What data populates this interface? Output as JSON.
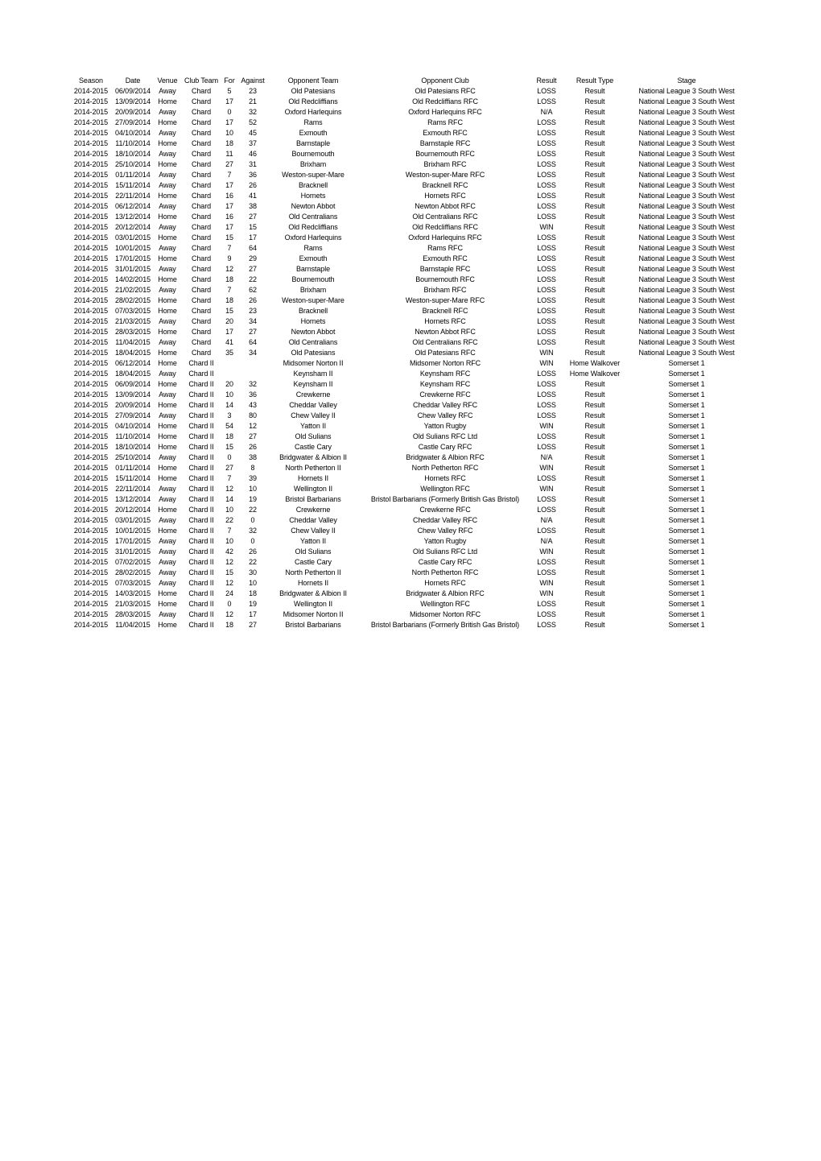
{
  "headers": [
    "Season",
    "Date",
    "Venue",
    "Club Team",
    "For",
    "Against",
    "Opponent Team",
    "Opponent Club",
    "Result",
    "Result Type",
    "Stage"
  ],
  "rows": [
    [
      "2014-2015",
      "06/09/2014",
      "Away",
      "Chard",
      "5",
      "23",
      "Old Patesians",
      "Old Patesians RFC",
      "LOSS",
      "Result",
      "National League 3 South West"
    ],
    [
      "2014-2015",
      "13/09/2014",
      "Home",
      "Chard",
      "17",
      "21",
      "Old Redcliffians",
      "Old Redcliffians RFC",
      "LOSS",
      "Result",
      "National League 3 South West"
    ],
    [
      "2014-2015",
      "20/09/2014",
      "Away",
      "Chard",
      "0",
      "32",
      "Oxford Harlequins",
      "Oxford Harlequins RFC",
      "N/A",
      "Result",
      "National League 3 South West"
    ],
    [
      "2014-2015",
      "27/09/2014",
      "Home",
      "Chard",
      "17",
      "52",
      "Rams",
      "Rams RFC",
      "LOSS",
      "Result",
      "National League 3 South West"
    ],
    [
      "2014-2015",
      "04/10/2014",
      "Away",
      "Chard",
      "10",
      "45",
      "Exmouth",
      "Exmouth RFC",
      "LOSS",
      "Result",
      "National League 3 South West"
    ],
    [
      "2014-2015",
      "11/10/2014",
      "Home",
      "Chard",
      "18",
      "37",
      "Barnstaple",
      "Barnstaple RFC",
      "LOSS",
      "Result",
      "National League 3 South West"
    ],
    [
      "2014-2015",
      "18/10/2014",
      "Away",
      "Chard",
      "11",
      "46",
      "Bournemouth",
      "Bournemouth RFC",
      "LOSS",
      "Result",
      "National League 3 South West"
    ],
    [
      "2014-2015",
      "25/10/2014",
      "Home",
      "Chard",
      "27",
      "31",
      "Brixham",
      "Brixham RFC",
      "LOSS",
      "Result",
      "National League 3 South West"
    ],
    [
      "2014-2015",
      "01/11/2014",
      "Away",
      "Chard",
      "7",
      "36",
      "Weston-super-Mare",
      "Weston-super-Mare RFC",
      "LOSS",
      "Result",
      "National League 3 South West"
    ],
    [
      "2014-2015",
      "15/11/2014",
      "Away",
      "Chard",
      "17",
      "26",
      "Bracknell",
      "Bracknell RFC",
      "LOSS",
      "Result",
      "National League 3 South West"
    ],
    [
      "2014-2015",
      "22/11/2014",
      "Home",
      "Chard",
      "16",
      "41",
      "Hornets",
      "Hornets RFC",
      "LOSS",
      "Result",
      "National League 3 South West"
    ],
    [
      "2014-2015",
      "06/12/2014",
      "Away",
      "Chard",
      "17",
      "38",
      "Newton Abbot",
      "Newton Abbot RFC",
      "LOSS",
      "Result",
      "National League 3 South West"
    ],
    [
      "2014-2015",
      "13/12/2014",
      "Home",
      "Chard",
      "16",
      "27",
      "Old Centralians",
      "Old Centralians RFC",
      "LOSS",
      "Result",
      "National League 3 South West"
    ],
    [
      "2014-2015",
      "20/12/2014",
      "Away",
      "Chard",
      "17",
      "15",
      "Old Redcliffians",
      "Old Redcliffians RFC",
      "WIN",
      "Result",
      "National League 3 South West"
    ],
    [
      "2014-2015",
      "03/01/2015",
      "Home",
      "Chard",
      "15",
      "17",
      "Oxford Harlequins",
      "Oxford Harlequins RFC",
      "LOSS",
      "Result",
      "National League 3 South West"
    ],
    [
      "2014-2015",
      "10/01/2015",
      "Away",
      "Chard",
      "7",
      "64",
      "Rams",
      "Rams RFC",
      "LOSS",
      "Result",
      "National League 3 South West"
    ],
    [
      "2014-2015",
      "17/01/2015",
      "Home",
      "Chard",
      "9",
      "29",
      "Exmouth",
      "Exmouth RFC",
      "LOSS",
      "Result",
      "National League 3 South West"
    ],
    [
      "2014-2015",
      "31/01/2015",
      "Away",
      "Chard",
      "12",
      "27",
      "Barnstaple",
      "Barnstaple RFC",
      "LOSS",
      "Result",
      "National League 3 South West"
    ],
    [
      "2014-2015",
      "14/02/2015",
      "Home",
      "Chard",
      "18",
      "22",
      "Bournemouth",
      "Bournemouth RFC",
      "LOSS",
      "Result",
      "National League 3 South West"
    ],
    [
      "2014-2015",
      "21/02/2015",
      "Away",
      "Chard",
      "7",
      "62",
      "Brixham",
      "Brixham RFC",
      "LOSS",
      "Result",
      "National League 3 South West"
    ],
    [
      "2014-2015",
      "28/02/2015",
      "Home",
      "Chard",
      "18",
      "26",
      "Weston-super-Mare",
      "Weston-super-Mare RFC",
      "LOSS",
      "Result",
      "National League 3 South West"
    ],
    [
      "2014-2015",
      "07/03/2015",
      "Home",
      "Chard",
      "15",
      "23",
      "Bracknell",
      "Bracknell RFC",
      "LOSS",
      "Result",
      "National League 3 South West"
    ],
    [
      "2014-2015",
      "21/03/2015",
      "Away",
      "Chard",
      "20",
      "34",
      "Hornets",
      "Hornets RFC",
      "LOSS",
      "Result",
      "National League 3 South West"
    ],
    [
      "2014-2015",
      "28/03/2015",
      "Home",
      "Chard",
      "17",
      "27",
      "Newton Abbot",
      "Newton Abbot RFC",
      "LOSS",
      "Result",
      "National League 3 South West"
    ],
    [
      "2014-2015",
      "11/04/2015",
      "Away",
      "Chard",
      "41",
      "64",
      "Old Centralians",
      "Old Centralians RFC",
      "LOSS",
      "Result",
      "National League 3 South West"
    ],
    [
      "2014-2015",
      "18/04/2015",
      "Home",
      "Chard",
      "35",
      "34",
      "Old Patesians",
      "Old Patesians RFC",
      "WIN",
      "Result",
      "National League 3 South West"
    ],
    [
      "2014-2015",
      "06/12/2014",
      "Home",
      "Chard II",
      "",
      "",
      "Midsomer Norton II",
      "Midsomer Norton RFC",
      "WIN",
      "Home Walkover",
      "Somerset 1"
    ],
    [
      "2014-2015",
      "18/04/2015",
      "Away",
      "Chard II",
      "",
      "",
      "Keynsham II",
      "Keynsham RFC",
      "LOSS",
      "Home Walkover",
      "Somerset 1"
    ],
    [
      "2014-2015",
      "06/09/2014",
      "Home",
      "Chard II",
      "20",
      "32",
      "Keynsham II",
      "Keynsham RFC",
      "LOSS",
      "Result",
      "Somerset 1"
    ],
    [
      "2014-2015",
      "13/09/2014",
      "Away",
      "Chard II",
      "10",
      "36",
      "Crewkerne",
      "Crewkerne RFC",
      "LOSS",
      "Result",
      "Somerset 1"
    ],
    [
      "2014-2015",
      "20/09/2014",
      "Home",
      "Chard II",
      "14",
      "43",
      "Cheddar Valley",
      "Cheddar Valley RFC",
      "LOSS",
      "Result",
      "Somerset 1"
    ],
    [
      "2014-2015",
      "27/09/2014",
      "Away",
      "Chard II",
      "3",
      "80",
      "Chew Valley II",
      "Chew Valley RFC",
      "LOSS",
      "Result",
      "Somerset 1"
    ],
    [
      "2014-2015",
      "04/10/2014",
      "Home",
      "Chard II",
      "54",
      "12",
      "Yatton II",
      "Yatton Rugby",
      "WIN",
      "Result",
      "Somerset 1"
    ],
    [
      "2014-2015",
      "11/10/2014",
      "Home",
      "Chard II",
      "18",
      "27",
      "Old Sulians",
      "Old Sulians RFC Ltd",
      "LOSS",
      "Result",
      "Somerset 1"
    ],
    [
      "2014-2015",
      "18/10/2014",
      "Home",
      "Chard II",
      "15",
      "26",
      "Castle Cary",
      "Castle Cary RFC",
      "LOSS",
      "Result",
      "Somerset 1"
    ],
    [
      "2014-2015",
      "25/10/2014",
      "Away",
      "Chard II",
      "0",
      "38",
      "Bridgwater & Albion II",
      "Bridgwater & Albion RFC",
      "N/A",
      "Result",
      "Somerset 1"
    ],
    [
      "2014-2015",
      "01/11/2014",
      "Home",
      "Chard II",
      "27",
      "8",
      "North Petherton II",
      "North Petherton RFC",
      "WIN",
      "Result",
      "Somerset 1"
    ],
    [
      "2014-2015",
      "15/11/2014",
      "Home",
      "Chard II",
      "7",
      "39",
      "Hornets II",
      "Hornets RFC",
      "LOSS",
      "Result",
      "Somerset 1"
    ],
    [
      "2014-2015",
      "22/11/2014",
      "Away",
      "Chard II",
      "12",
      "10",
      "Wellington II",
      "Wellington RFC",
      "WIN",
      "Result",
      "Somerset 1"
    ],
    [
      "2014-2015",
      "13/12/2014",
      "Away",
      "Chard II",
      "14",
      "19",
      "Bristol Barbarians",
      "Bristol Barbarians (Formerly British Gas Bristol)",
      "LOSS",
      "Result",
      "Somerset 1"
    ],
    [
      "2014-2015",
      "20/12/2014",
      "Home",
      "Chard II",
      "10",
      "22",
      "Crewkerne",
      "Crewkerne RFC",
      "LOSS",
      "Result",
      "Somerset 1"
    ],
    [
      "2014-2015",
      "03/01/2015",
      "Away",
      "Chard II",
      "22",
      "0",
      "Cheddar Valley",
      "Cheddar Valley RFC",
      "N/A",
      "Result",
      "Somerset 1"
    ],
    [
      "2014-2015",
      "10/01/2015",
      "Home",
      "Chard II",
      "7",
      "32",
      "Chew Valley II",
      "Chew Valley RFC",
      "LOSS",
      "Result",
      "Somerset 1"
    ],
    [
      "2014-2015",
      "17/01/2015",
      "Away",
      "Chard II",
      "10",
      "0",
      "Yatton II",
      "Yatton Rugby",
      "N/A",
      "Result",
      "Somerset 1"
    ],
    [
      "2014-2015",
      "31/01/2015",
      "Away",
      "Chard II",
      "42",
      "26",
      "Old Sulians",
      "Old Sulians RFC Ltd",
      "WIN",
      "Result",
      "Somerset 1"
    ],
    [
      "2014-2015",
      "07/02/2015",
      "Away",
      "Chard II",
      "12",
      "22",
      "Castle Cary",
      "Castle Cary RFC",
      "LOSS",
      "Result",
      "Somerset 1"
    ],
    [
      "2014-2015",
      "28/02/2015",
      "Away",
      "Chard II",
      "15",
      "30",
      "North Petherton II",
      "North Petherton RFC",
      "LOSS",
      "Result",
      "Somerset 1"
    ],
    [
      "2014-2015",
      "07/03/2015",
      "Away",
      "Chard II",
      "12",
      "10",
      "Hornets II",
      "Hornets RFC",
      "WIN",
      "Result",
      "Somerset 1"
    ],
    [
      "2014-2015",
      "14/03/2015",
      "Home",
      "Chard II",
      "24",
      "18",
      "Bridgwater & Albion II",
      "Bridgwater & Albion RFC",
      "WIN",
      "Result",
      "Somerset 1"
    ],
    [
      "2014-2015",
      "21/03/2015",
      "Home",
      "Chard II",
      "0",
      "19",
      "Wellington II",
      "Wellington RFC",
      "LOSS",
      "Result",
      "Somerset 1"
    ],
    [
      "2014-2015",
      "28/03/2015",
      "Away",
      "Chard II",
      "12",
      "17",
      "Midsomer Norton II",
      "Midsomer Norton RFC",
      "LOSS",
      "Result",
      "Somerset 1"
    ],
    [
      "2014-2015",
      "11/04/2015",
      "Home",
      "Chard II",
      "18",
      "27",
      "Bristol Barbarians",
      "Bristol Barbarians (Formerly British Gas Bristol)",
      "LOSS",
      "Result",
      "Somerset 1"
    ]
  ]
}
